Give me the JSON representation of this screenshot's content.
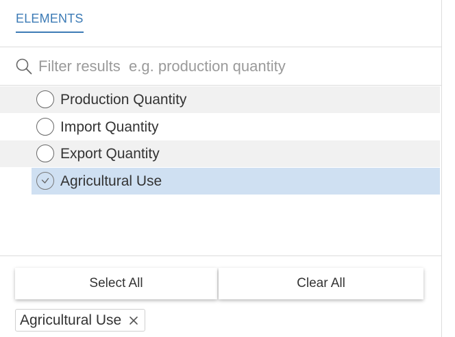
{
  "tabs": [
    {
      "label": "ELEMENTS",
      "active": true
    }
  ],
  "search": {
    "value": "",
    "placeholder": "Filter results  e.g. production quantity",
    "icon": "search-icon"
  },
  "items": [
    {
      "label": "Production Quantity",
      "selected": false
    },
    {
      "label": "Import Quantity",
      "selected": false
    },
    {
      "label": "Export Quantity",
      "selected": false
    },
    {
      "label": "Agricultural Use",
      "selected": true
    }
  ],
  "buttons": {
    "select_all": "Select All",
    "clear_all": "Clear All"
  },
  "chips": [
    {
      "label": "Agricultural Use",
      "close_icon": "close-icon"
    }
  ],
  "colors": {
    "accent": "#3b7ab5",
    "selected_row": "#cfe0f2",
    "alt_row": "#f1f1f1",
    "border": "#dcdcdc"
  }
}
